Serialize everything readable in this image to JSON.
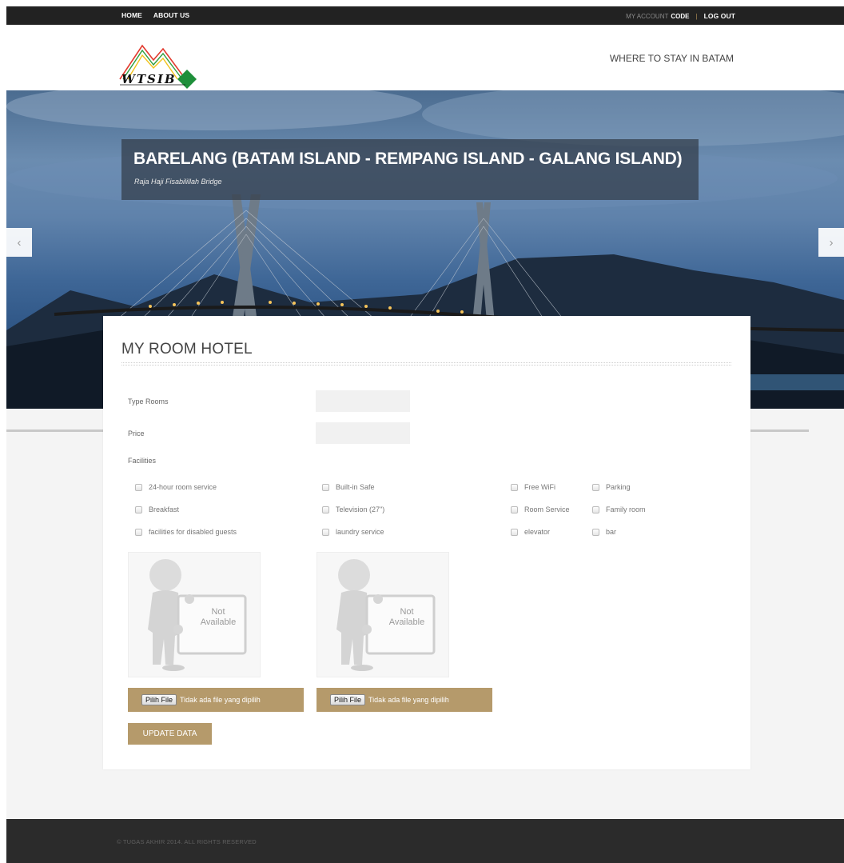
{
  "topbar": {
    "nav": [
      "HOME",
      "ABOUT US"
    ],
    "account_label": "MY ACCOUNT",
    "account_user": "CODE",
    "separator": "|",
    "logout": "LOG OUT"
  },
  "header": {
    "logo_text": "WTSIB",
    "logo_subtext": "WHERE TO STAY IN BATAM",
    "tagline": "WHERE TO STAY IN BATAM"
  },
  "hero": {
    "title": "BARELANG (BATAM ISLAND - REMPANG ISLAND - GALANG ISLAND)",
    "subtitle": "Raja Haji Fisabilillah Bridge",
    "prev_icon": "chevron-left-icon",
    "next_icon": "chevron-right-icon",
    "prev_glyph": "‹",
    "next_glyph": "›"
  },
  "form": {
    "title": "MY ROOM HOTEL",
    "type_rooms_label": "Type Rooms",
    "type_rooms_value": "",
    "price_label": "Price",
    "price_value": "",
    "facilities_label": "Facilities",
    "facilities": [
      "24-hour room service",
      "Built-in Safe",
      "Free WiFi",
      "Parking",
      "Breakfast",
      "Television (27\")",
      "Room Service",
      "Family room",
      "facilities for disabled guests",
      "laundry service",
      "elevator",
      "bar"
    ],
    "image_placeholder": [
      "Not",
      "Available"
    ],
    "file_button": "Pilih File",
    "file_status": "Tidak ada file yang dipilih",
    "update_button": "UPDATE DATA"
  },
  "footer": {
    "copyright": "© TUGAS AKHIR 2014. ALL RIGHTS RESERVED"
  },
  "colors": {
    "accent": "#b59a6b",
    "topbar": "#222222",
    "footer": "#2b2b2b"
  }
}
